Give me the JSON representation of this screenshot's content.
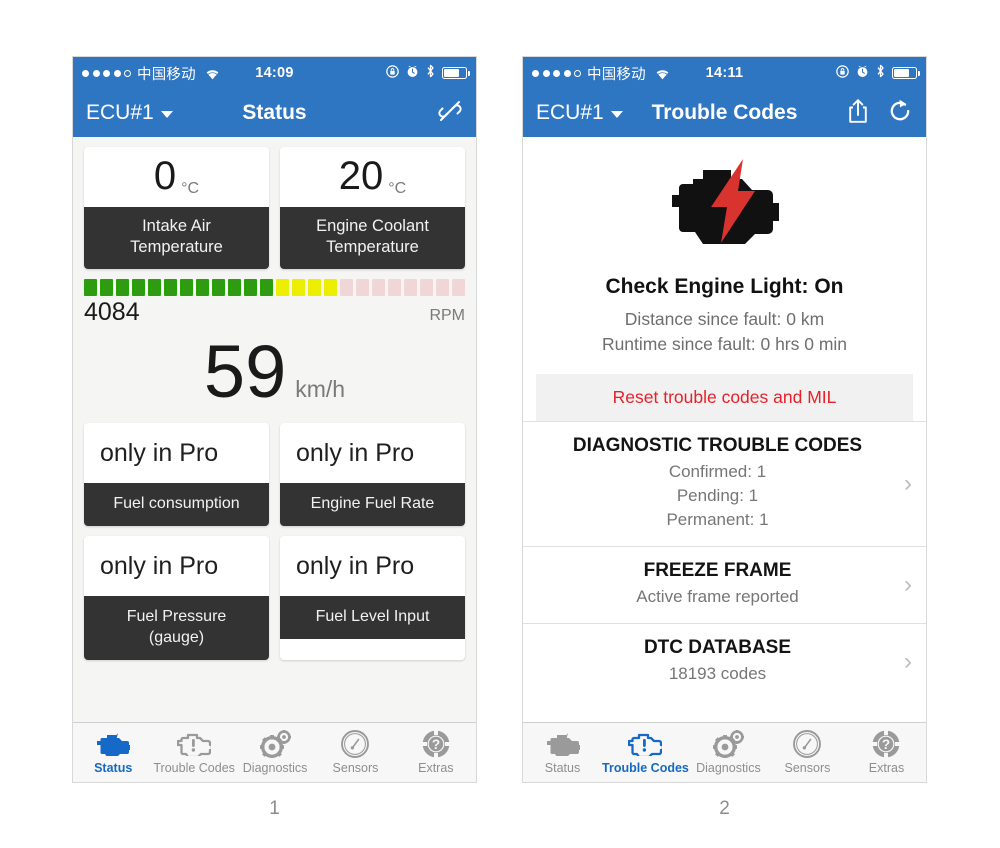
{
  "figure": {
    "captions": [
      "1",
      "2"
    ]
  },
  "colors": {
    "nav_blue": "#2e75c2",
    "tile_label_dark": "#333333",
    "reset_red": "#e8202a",
    "active_tab_blue": "#1669c6",
    "rpm_green": "#2e9c0f",
    "rpm_yellow": "#eded00",
    "rpm_empty": "#f0d6d6"
  },
  "tabs": [
    {
      "label": "Status",
      "icon": "check-engine-icon"
    },
    {
      "label": "Trouble Codes",
      "icon": "engine-warning-icon"
    },
    {
      "label": "Diagnostics",
      "icon": "gears-icon"
    },
    {
      "label": "Sensors",
      "icon": "gauge-icon"
    },
    {
      "label": "Extras",
      "icon": "help-wheel-icon"
    }
  ],
  "screen1": {
    "statusbar": {
      "signal_dots_filled": 4,
      "signal_dots_total": 5,
      "carrier": "中国移动",
      "wifi_icon": "wifi-icon",
      "time": "14:09",
      "icons": [
        "rotation-lock-icon",
        "alarm-clock-icon",
        "bluetooth-icon",
        "battery-icon"
      ],
      "battery_percent": 62
    },
    "navbar": {
      "ecu_label": "ECU#1",
      "dropdown_icon": "chevron-down-icon",
      "title": "Status",
      "right_icon": "unlink-icon"
    },
    "gauges": [
      {
        "value": "0",
        "unit": "°C",
        "label": "Intake Air\nTemperature",
        "label_line1": "Intake Air",
        "label_line2": "Temperature"
      },
      {
        "value": "20",
        "unit": "°C",
        "label": "Engine Coolant\nTemperature",
        "label_line1": "Engine Coolant",
        "label_line2": "Temperature"
      }
    ],
    "rpm": {
      "value": "4084",
      "unit": "RPM",
      "segments_total": 24,
      "segments_green": 12,
      "segments_yellow": 4,
      "segments_empty": 8
    },
    "speed": {
      "value": "59",
      "unit": "km/h"
    },
    "pro_tiles": [
      {
        "value": "only in Pro",
        "label": "Fuel consumption"
      },
      {
        "value": "only in Pro",
        "label": "Engine Fuel Rate"
      },
      {
        "value": "only in Pro",
        "label_line1": "Fuel Pressure",
        "label_line2": "(gauge)"
      },
      {
        "value": "only in Pro",
        "label": "Fuel Level Input"
      }
    ],
    "active_tab": "Status"
  },
  "screen2": {
    "statusbar": {
      "signal_dots_filled": 4,
      "signal_dots_total": 5,
      "carrier": "中国移动",
      "wifi_icon": "wifi-icon",
      "time": "14:11",
      "icons": [
        "rotation-lock-icon",
        "alarm-clock-icon",
        "bluetooth-icon",
        "battery-icon"
      ],
      "battery_percent": 62
    },
    "navbar": {
      "ecu_label": "ECU#1",
      "dropdown_icon": "chevron-down-icon",
      "title": "Trouble Codes",
      "right_icons": [
        "share-icon",
        "refresh-icon"
      ]
    },
    "hero": {
      "icon": "check-engine-light-icon",
      "title": "Check Engine Light: On",
      "line1": "Distance since fault: 0 km",
      "line2": "Runtime since fault: 0 hrs 0 min"
    },
    "reset_button": "Reset trouble codes and MIL",
    "rows": [
      {
        "title": "DIAGNOSTIC TROUBLE CODES",
        "sub1": "Confirmed: 1",
        "sub2": "Pending: 1",
        "sub3": "Permanent: 1",
        "chevron": "chevron-right-icon"
      },
      {
        "title": "FREEZE FRAME",
        "sub1": "Active frame reported",
        "chevron": "chevron-right-icon"
      },
      {
        "title": "DTC DATABASE",
        "sub1": "18193 codes",
        "chevron": "chevron-right-icon"
      }
    ],
    "active_tab": "Trouble Codes"
  }
}
